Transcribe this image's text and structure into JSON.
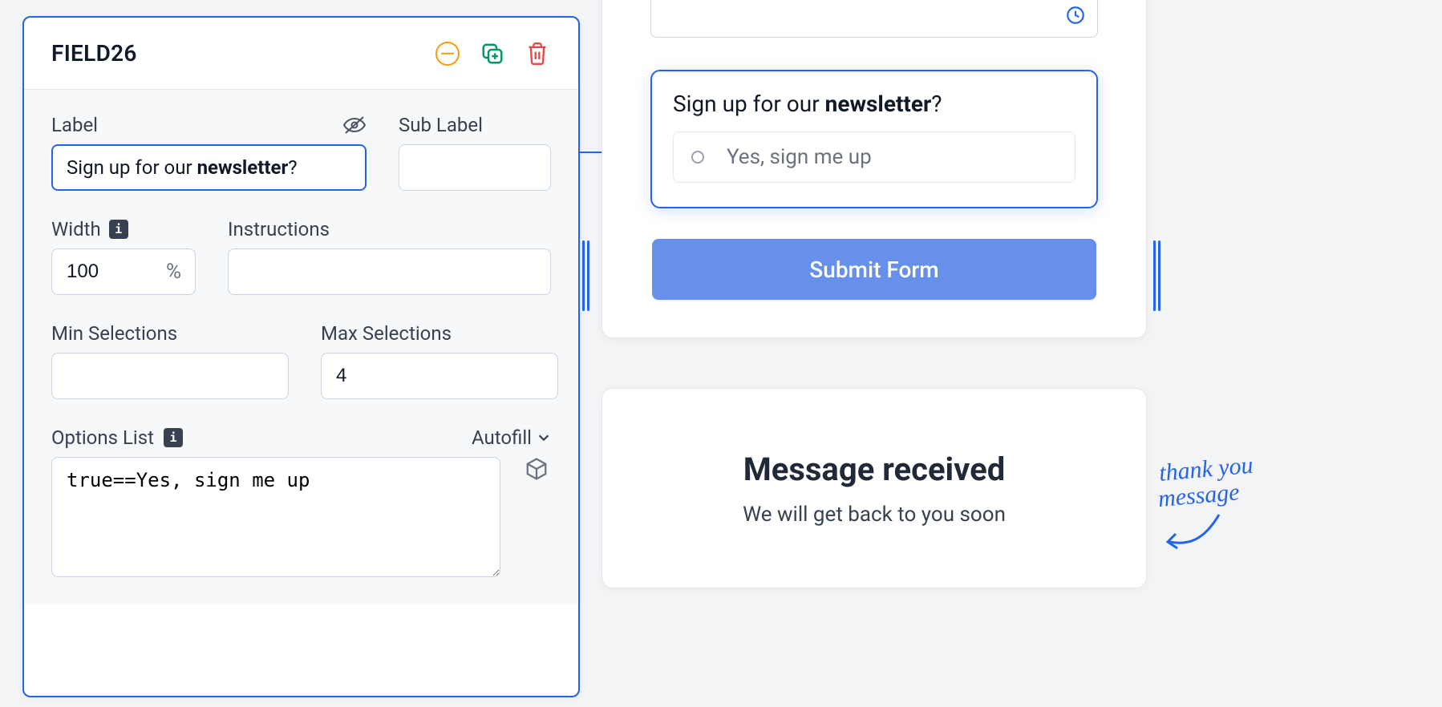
{
  "editor": {
    "field_id": "FIELD26",
    "sections": {
      "label": {
        "title": "Label",
        "value_prefix": "Sign up for our ",
        "value_bold": "newsletter",
        "value_suffix": "?"
      },
      "sub_label": {
        "title": "Sub Label",
        "value": ""
      },
      "width": {
        "title": "Width",
        "value": "100",
        "unit": "%"
      },
      "instructions": {
        "title": "Instructions",
        "value": ""
      },
      "min_selections": {
        "title": "Min Selections",
        "value": ""
      },
      "max_selections": {
        "title": "Max Selections",
        "value": "4"
      },
      "options_list": {
        "title": "Options List",
        "autofill_label": "Autofill",
        "value": "true==Yes, sign me up"
      }
    }
  },
  "preview": {
    "question_prefix": "Sign up for our ",
    "question_bold": "newsletter",
    "question_suffix": "?",
    "option_label": "Yes, sign me up",
    "submit_label": "Submit Form"
  },
  "thank_you": {
    "title": "Message received",
    "subtitle": "We will get back to you soon"
  },
  "annotation": {
    "line1": "thank you",
    "line2": "message"
  }
}
